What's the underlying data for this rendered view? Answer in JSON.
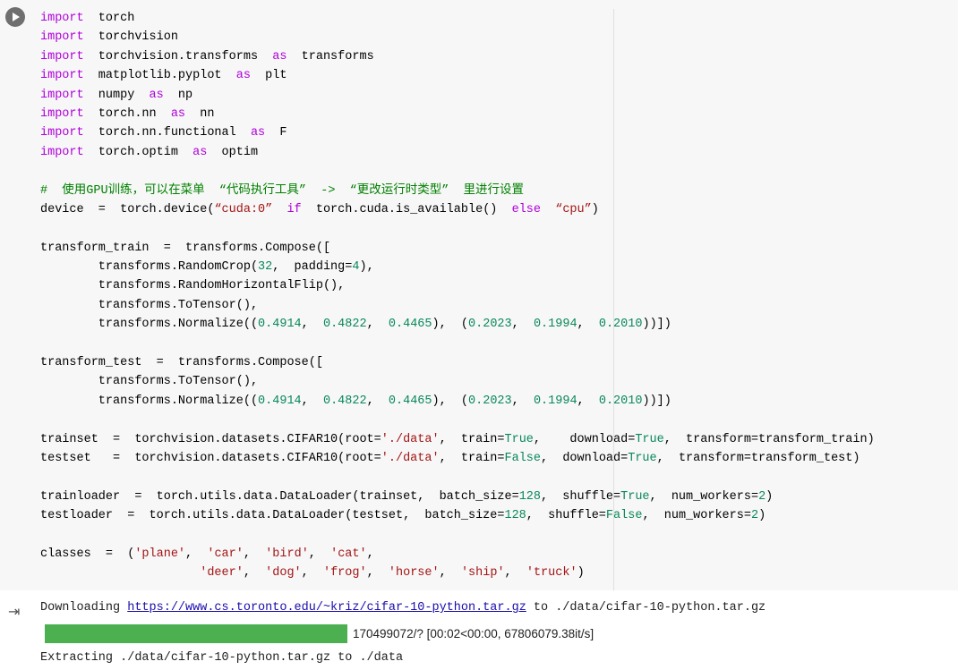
{
  "cell": {
    "run_button_icon": "play-icon",
    "lines": [
      [
        [
          "kw",
          "import"
        ],
        [
          "t",
          "  torch"
        ]
      ],
      [
        [
          "kw",
          "import"
        ],
        [
          "t",
          "  torchvision"
        ]
      ],
      [
        [
          "kw",
          "import"
        ],
        [
          "t",
          "  torchvision.transforms  "
        ],
        [
          "kw",
          "as"
        ],
        [
          "t",
          "  transforms"
        ]
      ],
      [
        [
          "kw",
          "import"
        ],
        [
          "t",
          "  matplotlib.pyplot  "
        ],
        [
          "kw",
          "as"
        ],
        [
          "t",
          "  plt"
        ]
      ],
      [
        [
          "kw",
          "import"
        ],
        [
          "t",
          "  numpy  "
        ],
        [
          "kw",
          "as"
        ],
        [
          "t",
          "  np"
        ]
      ],
      [
        [
          "kw",
          "import"
        ],
        [
          "t",
          "  torch.nn  "
        ],
        [
          "kw",
          "as"
        ],
        [
          "t",
          "  nn"
        ]
      ],
      [
        [
          "kw",
          "import"
        ],
        [
          "t",
          "  torch.nn.functional  "
        ],
        [
          "kw",
          "as"
        ],
        [
          "t",
          "  F"
        ]
      ],
      [
        [
          "kw",
          "import"
        ],
        [
          "t",
          "  torch.optim  "
        ],
        [
          "kw",
          "as"
        ],
        [
          "t",
          "  optim"
        ]
      ],
      [],
      [
        [
          "cm",
          "#  使用GPU训练，可以在菜单  “代码执行工具”  ->  “更改运行时类型”  里进行设置"
        ]
      ],
      [
        [
          "t",
          "device  =  torch.device("
        ],
        [
          "str",
          "“cuda:0”"
        ],
        [
          "t",
          "  "
        ],
        [
          "kw",
          "if"
        ],
        [
          "t",
          "  torch.cuda.is_available()  "
        ],
        [
          "kw",
          "else"
        ],
        [
          "t",
          "  "
        ],
        [
          "str",
          "“cpu”"
        ],
        [
          "t",
          ")"
        ]
      ],
      [],
      [
        [
          "t",
          "transform_train  =  transforms.Compose(["
        ]
      ],
      [
        [
          "t",
          "        transforms.RandomCrop("
        ],
        [
          "num",
          "32"
        ],
        [
          "t",
          ",  padding="
        ],
        [
          "num",
          "4"
        ],
        [
          "t",
          "),"
        ]
      ],
      [
        [
          "t",
          "        transforms.RandomHorizontalFlip(),"
        ]
      ],
      [
        [
          "t",
          "        transforms.ToTensor(),"
        ]
      ],
      [
        [
          "t",
          "        transforms.Normalize(("
        ],
        [
          "num",
          "0.4914"
        ],
        [
          "t",
          ",  "
        ],
        [
          "num",
          "0.4822"
        ],
        [
          "t",
          ",  "
        ],
        [
          "num",
          "0.4465"
        ],
        [
          "t",
          "),  ("
        ],
        [
          "num",
          "0.2023"
        ],
        [
          "t",
          ",  "
        ],
        [
          "num",
          "0.1994"
        ],
        [
          "t",
          ",  "
        ],
        [
          "num",
          "0.2010"
        ],
        [
          "t",
          "))])"
        ]
      ],
      [],
      [
        [
          "t",
          "transform_test  =  transforms.Compose(["
        ]
      ],
      [
        [
          "t",
          "        transforms.ToTensor(),"
        ]
      ],
      [
        [
          "t",
          "        transforms.Normalize(("
        ],
        [
          "num",
          "0.4914"
        ],
        [
          "t",
          ",  "
        ],
        [
          "num",
          "0.4822"
        ],
        [
          "t",
          ",  "
        ],
        [
          "num",
          "0.4465"
        ],
        [
          "t",
          "),  ("
        ],
        [
          "num",
          "0.2023"
        ],
        [
          "t",
          ",  "
        ],
        [
          "num",
          "0.1994"
        ],
        [
          "t",
          ",  "
        ],
        [
          "num",
          "0.2010"
        ],
        [
          "t",
          "))])"
        ]
      ],
      [],
      [
        [
          "t",
          "trainset  =  torchvision.datasets.CIFAR10(root="
        ],
        [
          "str",
          "'./data'"
        ],
        [
          "t",
          ",  train="
        ],
        [
          "num",
          "True"
        ],
        [
          "t",
          ",    download="
        ],
        [
          "num",
          "True"
        ],
        [
          "t",
          ",  transform=transform_train)"
        ]
      ],
      [
        [
          "t",
          "testset   =  torchvision.datasets.CIFAR10(root="
        ],
        [
          "str",
          "'./data'"
        ],
        [
          "t",
          ",  train="
        ],
        [
          "num",
          "False"
        ],
        [
          "t",
          ",  download="
        ],
        [
          "num",
          "True"
        ],
        [
          "t",
          ",  transform=transform_test)"
        ]
      ],
      [],
      [
        [
          "t",
          "trainloader  =  torch.utils.data.DataLoader(trainset,  batch_size="
        ],
        [
          "num",
          "128"
        ],
        [
          "t",
          ",  shuffle="
        ],
        [
          "num",
          "True"
        ],
        [
          "t",
          ",  num_workers="
        ],
        [
          "num",
          "2"
        ],
        [
          "t",
          ")"
        ]
      ],
      [
        [
          "t",
          "testloader  =  torch.utils.data.DataLoader(testset,  batch_size="
        ],
        [
          "num",
          "128"
        ],
        [
          "t",
          ",  shuffle="
        ],
        [
          "num",
          "False"
        ],
        [
          "t",
          ",  num_workers="
        ],
        [
          "num",
          "2"
        ],
        [
          "t",
          ")"
        ]
      ],
      [],
      [
        [
          "t",
          "classes  =  ("
        ],
        [
          "str",
          "'plane'"
        ],
        [
          "t",
          ",  "
        ],
        [
          "str",
          "'car'"
        ],
        [
          "t",
          ",  "
        ],
        [
          "str",
          "'bird'"
        ],
        [
          "t",
          ",  "
        ],
        [
          "str",
          "'cat'"
        ],
        [
          "t",
          ","
        ]
      ],
      [
        [
          "t",
          "                      "
        ],
        [
          "str",
          "'deer'"
        ],
        [
          "t",
          ",  "
        ],
        [
          "str",
          "'dog'"
        ],
        [
          "t",
          ",  "
        ],
        [
          "str",
          "'frog'"
        ],
        [
          "t",
          ",  "
        ],
        [
          "str",
          "'horse'"
        ],
        [
          "t",
          ",  "
        ],
        [
          "str",
          "'ship'"
        ],
        [
          "t",
          ",  "
        ],
        [
          "str",
          "'truck'"
        ],
        [
          "t",
          ")"
        ]
      ]
    ]
  },
  "output": {
    "icon": "output-arrow-icon",
    "download_prefix": "Downloading ",
    "download_url": "https://www.cs.toronto.edu/~kriz/cifar-10-python.tar.gz",
    "download_suffix": " to ./data/cifar-10-python.tar.gz",
    "progress_fraction": 1.0,
    "progress_text": "170499072/? [00:02<00:00, 67806079.38it/s]",
    "extract_line": "Extracting ./data/cifar-10-python.tar.gz to ./data"
  }
}
